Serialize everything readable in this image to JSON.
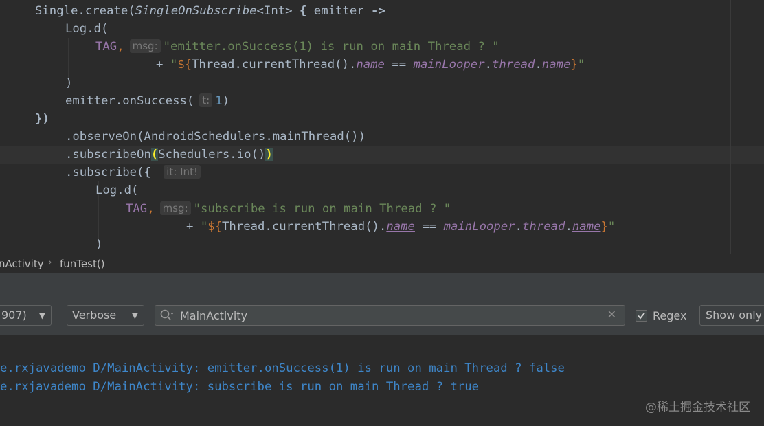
{
  "editor": {
    "lines": [
      {
        "tokens": [
          {
            "t": "Single.create(",
            "c": "t-def"
          },
          {
            "t": "SingleOnSubscribe",
            "c": "t-it"
          },
          {
            "t": "<Int> ",
            "c": "t-def"
          },
          {
            "t": "{",
            "c": "t-bold"
          },
          {
            "t": " emitter ",
            "c": "t-def"
          },
          {
            "t": "->",
            "c": "t-bold"
          }
        ]
      },
      {
        "tokens": [
          {
            "t": "Log.d(",
            "c": "t-def"
          }
        ]
      },
      {
        "tokens": [
          {
            "t": "TAG",
            "c": "t-const"
          },
          {
            "t": ",",
            "c": "t-kw"
          },
          {
            "hint": "msg:"
          },
          {
            "t": "\"emitter.onSuccess(1) is run on main Thread ? \"",
            "c": "t-str"
          }
        ]
      },
      {
        "tokens": [
          {
            "t": "+ ",
            "c": "t-def"
          },
          {
            "t": "\"",
            "c": "t-str"
          },
          {
            "t": "${",
            "c": "t-kw"
          },
          {
            "t": "Thread.currentThread().",
            "c": "t-def"
          },
          {
            "t": "name",
            "c": "t-fieldit-u"
          },
          {
            "t": " == ",
            "c": "t-def"
          },
          {
            "t": "mainLooper",
            "c": "t-fieldit"
          },
          {
            "t": ".",
            "c": "t-def"
          },
          {
            "t": "thread",
            "c": "t-fieldit"
          },
          {
            "t": ".",
            "c": "t-def"
          },
          {
            "t": "name",
            "c": "t-fieldit-u"
          },
          {
            "t": "}",
            "c": "t-kw"
          },
          {
            "t": "\"",
            "c": "t-str"
          }
        ]
      },
      {
        "tokens": [
          {
            "t": ")",
            "c": "t-def"
          }
        ]
      },
      {
        "tokens": [
          {
            "t": "emitter.onSuccess(",
            "c": "t-def"
          },
          {
            "hint": "t:"
          },
          {
            "t": "1",
            "c": "t-num"
          },
          {
            "t": ")",
            "c": "t-def"
          }
        ]
      },
      {
        "tokens": [
          {
            "t": "})",
            "c": "t-bold"
          }
        ]
      },
      {
        "tokens": [
          {
            "t": ".observeOn(AndroidSchedulers.mainThread())",
            "c": "t-def"
          }
        ]
      },
      {
        "tokens": [
          {
            "t": ".subscribeOn",
            "c": "t-def"
          },
          {
            "t": "(",
            "c": "t-brace-match"
          },
          {
            "t": "Schedulers.io()",
            "c": "t-def"
          },
          {
            "t": ")",
            "c": "t-brace-match"
          }
        ]
      },
      {
        "tokens": [
          {
            "t": ".subscribe(",
            "c": "t-def"
          },
          {
            "t": "{",
            "c": "t-bold"
          },
          {
            "t": " ",
            "c": "t-def"
          },
          {
            "hint": "it: Int!"
          }
        ]
      },
      {
        "tokens": [
          {
            "t": "Log.d(",
            "c": "t-def"
          }
        ]
      },
      {
        "tokens": [
          {
            "t": "TAG",
            "c": "t-const"
          },
          {
            "t": ",",
            "c": "t-kw"
          },
          {
            "hint": "msg:"
          },
          {
            "t": "\"subscribe is run on main Thread ? \"",
            "c": "t-str"
          }
        ]
      },
      {
        "tokens": [
          {
            "t": "+ ",
            "c": "t-def"
          },
          {
            "t": "\"",
            "c": "t-str"
          },
          {
            "t": "${",
            "c": "t-kw"
          },
          {
            "t": "Thread.currentThread().",
            "c": "t-def"
          },
          {
            "t": "name",
            "c": "t-fieldit-u"
          },
          {
            "t": " == ",
            "c": "t-def"
          },
          {
            "t": "mainLooper",
            "c": "t-fieldit"
          },
          {
            "t": ".",
            "c": "t-def"
          },
          {
            "t": "thread",
            "c": "t-fieldit"
          },
          {
            "t": ".",
            "c": "t-def"
          },
          {
            "t": "name",
            "c": "t-fieldit-u"
          },
          {
            "t": "}",
            "c": "t-kw"
          },
          {
            "t": "\"",
            "c": "t-str"
          }
        ]
      },
      {
        "tokens": [
          {
            "t": ")",
            "c": "t-def"
          }
        ]
      }
    ]
  },
  "breadcrumb": {
    "class_name": "nActivity",
    "method_name": "funTest()"
  },
  "logcat": {
    "process_value": "907)",
    "level_value": "Verbose",
    "search_value": "MainActivity",
    "regex_label": "Regex",
    "regex_checked": true,
    "show_only_label": "Show only s"
  },
  "log": {
    "lines": [
      "e.rxjavademo D/MainActivity: emitter.onSuccess(1) is run on main Thread ? false",
      "e.rxjavademo D/MainActivity: subscribe is run on main Thread ? true"
    ]
  },
  "watermark": "@稀土掘金技术社区",
  "colors": {
    "editor_bg": "#2b2b2b",
    "panel_bg": "#3c3f41",
    "string": "#6a8759",
    "keyword": "#cc7832",
    "field": "#9876aa",
    "number": "#6897bb",
    "log_text": "#3e86c9"
  }
}
